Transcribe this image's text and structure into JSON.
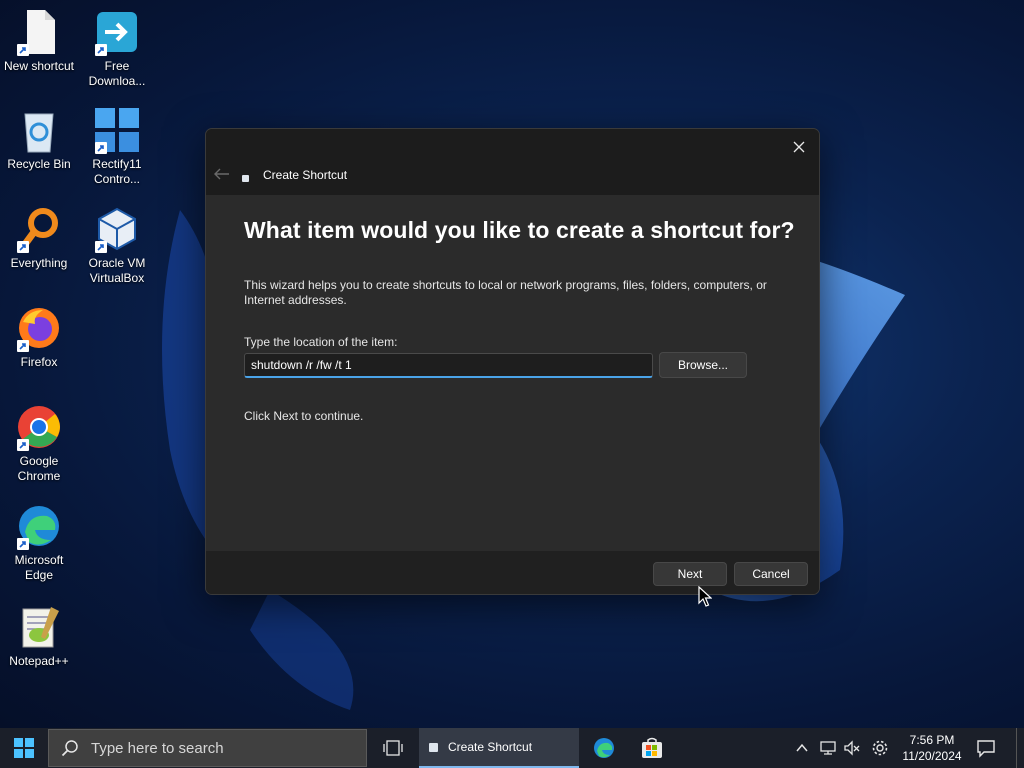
{
  "desktop": {
    "icons": [
      {
        "label": "New shortcut",
        "icon": "blank-document-icon"
      },
      {
        "label": "Free Downloa...",
        "icon": "download-manager-icon"
      },
      {
        "label": "Recycle Bin",
        "icon": "recycle-bin-icon"
      },
      {
        "label": "Rectify11 Contro...",
        "icon": "windows-control-icon"
      },
      {
        "label": "Everything",
        "icon": "magnifier-icon"
      },
      {
        "label": "Oracle VM VirtualBox",
        "icon": "virtualbox-cube-icon"
      },
      {
        "label": "Firefox",
        "icon": "firefox-icon"
      },
      {
        "label": "Google Chrome",
        "icon": "chrome-icon"
      },
      {
        "label": "Microsoft Edge",
        "icon": "edge-icon"
      },
      {
        "label": "Notepad++",
        "icon": "notepadpp-icon"
      }
    ]
  },
  "dialog": {
    "title": "Create Shortcut",
    "heading": "What item would you like to create a shortcut for?",
    "description": "This wizard helps you to create shortcuts to local or network programs, files, folders, computers, or Internet addresses.",
    "location_label": "Type the location of the item:",
    "location_value": "shutdown /r /fw /t 1",
    "browse_label": "Browse...",
    "continue_text": "Click Next to continue.",
    "next_label": "Next",
    "cancel_label": "Cancel"
  },
  "taskbar": {
    "search_placeholder": "Type here to search",
    "active_task": "Create Shortcut",
    "time": "7:56 PM",
    "date": "11/20/2024"
  },
  "colors": {
    "accent": "#4aa3e8",
    "dialog_bg": "#2b2b2b",
    "taskbar_bg": "#1b1f29"
  }
}
